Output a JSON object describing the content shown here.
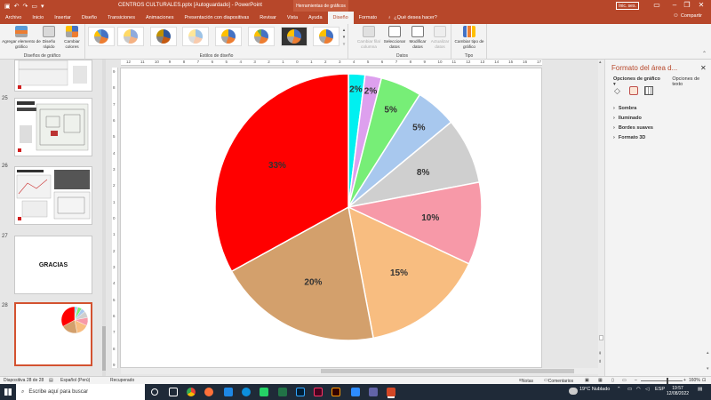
{
  "titlebar": {
    "title": "CENTROS CULTURALES.pptx [Autoguardado] - PowerPoint",
    "context_tools": "Herramientas de gráficos",
    "signin": "Inic. ses."
  },
  "tabs": [
    {
      "label": "Archivo"
    },
    {
      "label": "Inicio"
    },
    {
      "label": "Insertar"
    },
    {
      "label": "Diseño"
    },
    {
      "label": "Transiciones"
    },
    {
      "label": "Animaciones"
    },
    {
      "label": "Presentación con diapositivas"
    },
    {
      "label": "Revisar"
    },
    {
      "label": "Vista"
    },
    {
      "label": "Ayuda"
    },
    {
      "label": "Diseño"
    },
    {
      "label": "Formato"
    }
  ],
  "tellme": "¿Qué desea hacer?",
  "share": "Compartir",
  "ribbon": {
    "add_element": "Agregar elemento de gráfico",
    "quick_layout": "Diseño rápido",
    "change_colors": "Cambiar colores",
    "group_layouts": "Diseños de gráfico",
    "group_styles": "Estilos de diseño",
    "switch_rowcol": "Cambiar fila/ columna",
    "select_data": "Seleccionar datos",
    "edit_data": "Modificar datos",
    "refresh_data": "Actualizar datos",
    "group_data": "Datos",
    "change_type": "Cambiar tipo de gráfico",
    "group_type": "Tipo"
  },
  "slides": [
    {
      "num": "25"
    },
    {
      "num": "26"
    },
    {
      "num": "27",
      "text": "GRACIAS"
    },
    {
      "num": "28"
    }
  ],
  "ruler_h": [
    "12",
    "11",
    "10",
    "9",
    "8",
    "7",
    "6",
    "5",
    "4",
    "3",
    "2",
    "1",
    "0",
    "1",
    "2",
    "3",
    "4",
    "5",
    "6",
    "7",
    "8",
    "9",
    "10",
    "11",
    "12",
    "13",
    "14",
    "15",
    "16",
    "17"
  ],
  "ruler_v": [
    "9",
    "8",
    "7",
    "6",
    "5",
    "4",
    "3",
    "2",
    "1",
    "0",
    "1",
    "2",
    "3",
    "4",
    "5",
    "6",
    "7",
    "8",
    "9"
  ],
  "chart_data": {
    "type": "pie",
    "values": [
      2,
      2,
      5,
      5,
      8,
      10,
      15,
      20,
      33
    ],
    "labels": [
      "2%",
      "2%",
      "5%",
      "5%",
      "8%",
      "10%",
      "15%",
      "20%",
      "33%"
    ],
    "colors": [
      "#00f0f0",
      "#dda0ee",
      "#77ee77",
      "#a8c8ee",
      "#cfcfcf",
      "#f799a8",
      "#f8bd80",
      "#d3a06c",
      "#ff0000"
    ]
  },
  "pane": {
    "title": "Formato del área d...",
    "tab_chart": "Opciones de gráfico",
    "tab_text": "Opciones de texto",
    "sections": [
      "Sombra",
      "Iluminado",
      "Bordes suaves",
      "Formato 3D"
    ]
  },
  "status": {
    "slide": "Diapositiva 28 de 28",
    "lang": "Español (Perú)",
    "recovered": "Recuperado",
    "notes": "Notas",
    "comments": "Comentarios",
    "zoom": "160%"
  },
  "taskbar": {
    "search": "Escribe aquí para buscar",
    "weather": "19°C  Nublado",
    "lang": "ESP",
    "time": "19:57",
    "date": "12/08/2022"
  }
}
